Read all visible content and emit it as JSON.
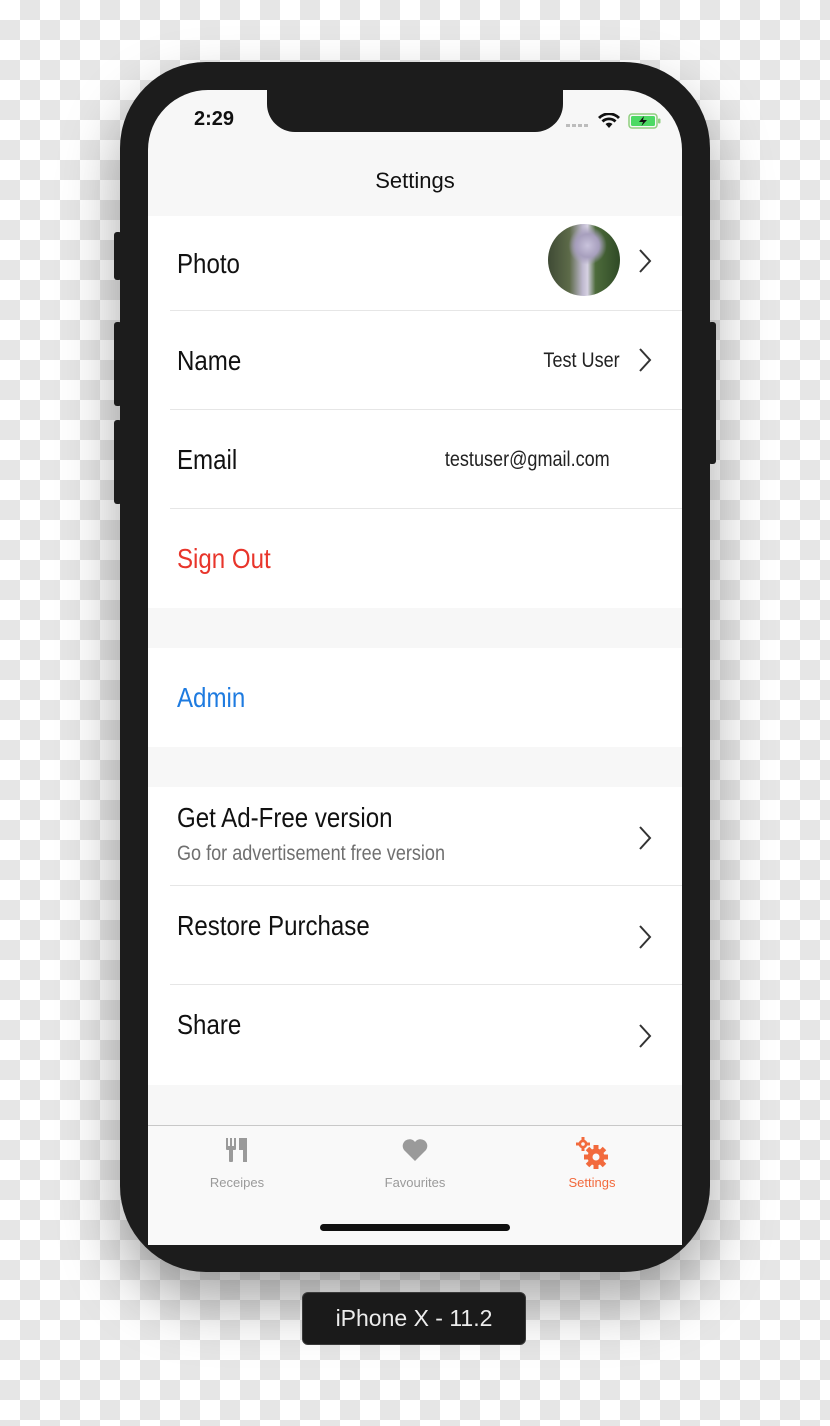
{
  "status_bar": {
    "time": "2:29",
    "icons": [
      "signal-dots-icon",
      "wifi-icon",
      "battery-charging-icon"
    ]
  },
  "nav": {
    "title": "Settings"
  },
  "sections": [
    {
      "rows": [
        {
          "label": "Photo",
          "value": "",
          "accessory": "chevron-right",
          "has_avatar": true
        },
        {
          "label": "Name",
          "value": "Test User",
          "accessory": "chevron-right"
        },
        {
          "label": "Email",
          "value": "testuser@gmail.com",
          "accessory": "none"
        },
        {
          "label": "Sign Out",
          "color": "#e8352b",
          "accessory": "none"
        }
      ]
    },
    {
      "rows": [
        {
          "label": "Admin",
          "color": "#1e7be0",
          "accessory": "none"
        }
      ]
    },
    {
      "rows": [
        {
          "label": "Get Ad-Free version",
          "subtitle": "Go for advertisement free version",
          "accessory": "chevron-right"
        },
        {
          "label": "Restore Purchase",
          "accessory": "chevron-right"
        },
        {
          "label": "Share",
          "accessory": "chevron-right"
        }
      ]
    }
  ],
  "tab_bar": {
    "tabs": [
      {
        "label": "Receipes",
        "icon": "fork-knife-icon",
        "active": false
      },
      {
        "label": "Favourites",
        "icon": "heart-icon",
        "active": false
      },
      {
        "label": "Settings",
        "icon": "gears-icon",
        "active": true
      }
    ],
    "active_color": "#f26a3d",
    "inactive_color": "#9a9a9a"
  },
  "device_label": "iPhone X - 11.2"
}
